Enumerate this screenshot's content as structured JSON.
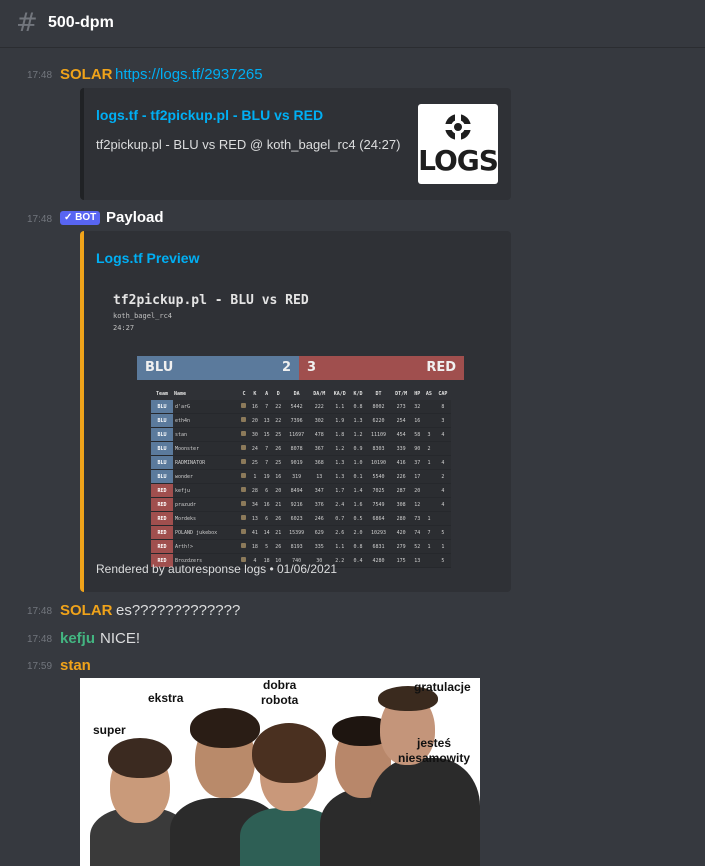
{
  "header": {
    "channel": "500-dpm"
  },
  "messages": [
    {
      "time": "17:48",
      "author": "SOLAR",
      "author_color": "#f0a31a",
      "link": "https://logs.tf/2937265",
      "embed": {
        "title": "logs.tf - tf2pickup.pl - BLU vs RED",
        "description": "tf2pickup.pl - BLU vs RED @ koth_bagel_rc4 (24:27)",
        "thumbnail_text": "LOGS"
      }
    },
    {
      "time": "17:48",
      "author": "Payload",
      "bot_tag": "✓ BOT",
      "embed": {
        "title": "Logs.tf Preview",
        "footer": "Rendered by autoresponse logs • 01/06/2021",
        "preview": {
          "title": "tf2pickup.pl - BLU vs RED",
          "map": "koth_bagel_rc4",
          "duration": "24:27",
          "blu_label": "BLU",
          "blu_score": "2",
          "red_label": "RED",
          "red_score": "3",
          "columns": [
            "Team",
            "Name",
            "C",
            "K",
            "A",
            "D",
            "DA",
            "DA/M",
            "KA/D",
            "K/D",
            "DT",
            "DT/M",
            "HP",
            "AS",
            "CAP"
          ],
          "rows": [
            {
              "team": "BLU",
              "name": "d'arG",
              "k": "16",
              "a": "7",
              "d": "22",
              "da": "5442",
              "dam": "222",
              "kad": "1.1",
              "kd": "0.8",
              "dt": "8002",
              "dtm": "273",
              "hp": "32",
              "as": "",
              "cap": "8"
            },
            {
              "team": "BLU",
              "name": "eth4n",
              "k": "20",
              "a": "13",
              "d": "22",
              "da": "7396",
              "dam": "302",
              "kad": "1.9",
              "kd": "1.3",
              "dt": "6220",
              "dtm": "254",
              "hp": "16",
              "as": "",
              "cap": "3"
            },
            {
              "team": "BLU",
              "name": "stan",
              "k": "30",
              "a": "15",
              "d": "25",
              "da": "11697",
              "dam": "478",
              "kad": "1.8",
              "kd": "1.2",
              "dt": "11109",
              "dtm": "454",
              "hp": "58",
              "as": "3",
              "cap": "4"
            },
            {
              "team": "BLU",
              "name": "Moonster",
              "k": "24",
              "a": "7",
              "d": "26",
              "da": "8078",
              "dam": "367",
              "kad": "1.2",
              "kd": "0.9",
              "dt": "8303",
              "dtm": "339",
              "hp": "90",
              "as": "2",
              "cap": ""
            },
            {
              "team": "BLU",
              "name": "RADMINATOR",
              "k": "25",
              "a": "7",
              "d": "25",
              "da": "9019",
              "dam": "368",
              "kad": "1.3",
              "kd": "1.0",
              "dt": "10190",
              "dtm": "416",
              "hp": "37",
              "as": "1",
              "cap": "4"
            },
            {
              "team": "BLU",
              "name": "wonder",
              "k": "1",
              "a": "19",
              "d": "16",
              "da": "319",
              "dam": "13",
              "kad": "1.3",
              "kd": "0.1",
              "dt": "5540",
              "dtm": "226",
              "hp": "17",
              "as": "",
              "cap": "2"
            },
            {
              "team": "RED",
              "name": "kefju",
              "k": "28",
              "a": "6",
              "d": "20",
              "da": "8494",
              "dam": "347",
              "kad": "1.7",
              "kd": "1.4",
              "dt": "7025",
              "dtm": "287",
              "hp": "20",
              "as": "",
              "cap": "4"
            },
            {
              "team": "RED",
              "name": "prazudr",
              "k": "34",
              "a": "16",
              "d": "21",
              "da": "9216",
              "dam": "376",
              "kad": "2.4",
              "kd": "1.6",
              "dt": "7549",
              "dtm": "308",
              "hp": "12",
              "as": "",
              "cap": "4"
            },
            {
              "team": "RED",
              "name": "Mordeks",
              "k": "13",
              "a": "6",
              "d": "26",
              "da": "6023",
              "dam": "246",
              "kad": "0.7",
              "kd": "0.5",
              "dt": "6864",
              "dtm": "280",
              "hp": "73",
              "as": "1",
              "cap": ""
            },
            {
              "team": "RED",
              "name": "POLAND jukebox",
              "k": "41",
              "a": "14",
              "d": "21",
              "da": "15399",
              "dam": "629",
              "kad": "2.6",
              "kd": "2.0",
              "dt": "10293",
              "dtm": "420",
              "hp": "74",
              "as": "7",
              "cap": "5"
            },
            {
              "team": "RED",
              "name": "Arth!>",
              "k": "18",
              "a": "5",
              "d": "26",
              "da": "8193",
              "dam": "335",
              "kad": "1.1",
              "kd": "0.8",
              "dt": "6831",
              "dtm": "279",
              "hp": "52",
              "as": "1",
              "cap": "1"
            },
            {
              "team": "RED",
              "name": "Brozdzers",
              "k": "4",
              "a": "18",
              "d": "10",
              "da": "740",
              "dam": "30",
              "kad": "2.2",
              "kd": "0.4",
              "dt": "4280",
              "dtm": "175",
              "hp": "13",
              "as": "",
              "cap": "5"
            }
          ]
        }
      }
    },
    {
      "time": "17:48",
      "author": "SOLAR",
      "author_color": "#f0a31a",
      "text": "es?????????????"
    },
    {
      "time": "17:48",
      "author": "kefju",
      "author_color": "#43b581",
      "text": "NICE!"
    },
    {
      "time": "17:59",
      "author": "stan",
      "author_color": "#f0a31a",
      "image": {
        "labels": [
          "super",
          "ekstra",
          "dobra\nrobota",
          "gratulacje",
          "jesteś\nniesamowity"
        ]
      }
    }
  ]
}
